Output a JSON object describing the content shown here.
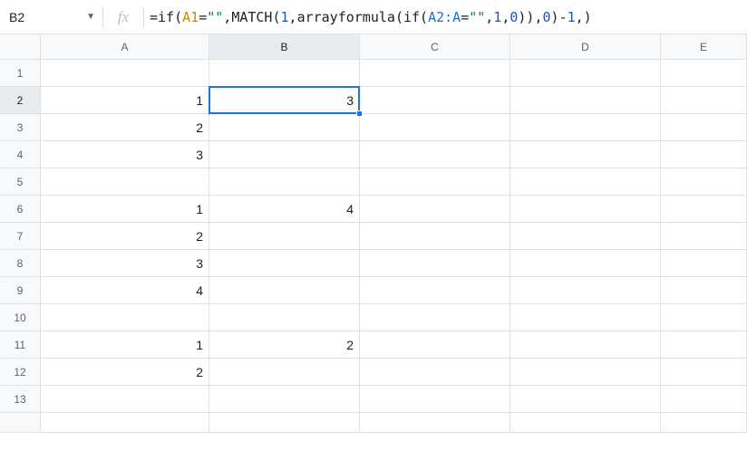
{
  "name_box": {
    "value": "B2"
  },
  "fx_label": "fx",
  "formula": {
    "raw": "=if(A1=\"\",MATCH(1,arrayformula(if(A2:A=\"\",1,0)),0)-1,)",
    "t0": "=",
    "t1": "if",
    "t2": "(",
    "t3": "A1",
    "t4": "=",
    "t5": "\"\"",
    "t6": ",",
    "t7": "MATCH",
    "t8": "(",
    "t9": "1",
    "t10": ",",
    "t11": "arrayformula",
    "t12": "(",
    "t13": "if",
    "t14": "(",
    "t15": "A2:A",
    "t16": "=",
    "t17": "\"\"",
    "t18": ",",
    "t19": "1",
    "t20": ",",
    "t21": "0",
    "t22": "))",
    "t23": ",",
    "t24": "0",
    "t25": ")",
    "t26": "-",
    "t27": "1",
    "t28": ",)"
  },
  "columns": {
    "c1": "A",
    "c2": "B",
    "c3": "C",
    "c4": "D",
    "c5": "E"
  },
  "rows": {
    "r1": "1",
    "r2": "2",
    "r3": "3",
    "r4": "4",
    "r5": "5",
    "r6": "6",
    "r7": "7",
    "r8": "8",
    "r9": "9",
    "r10": "10",
    "r11": "11",
    "r12": "12",
    "r13": "13"
  },
  "cells": {
    "A2": "1",
    "A3": "2",
    "A4": "3",
    "A6": "1",
    "A7": "2",
    "A8": "3",
    "A9": "4",
    "A11": "1",
    "A12": "2",
    "B2": "3",
    "B6": "4",
    "B11": "2"
  },
  "selection": {
    "cell": "B2"
  },
  "chart_data": {
    "type": "table",
    "columns": [
      "A",
      "B",
      "C",
      "D",
      "E"
    ],
    "rows": [
      {
        "row": 1,
        "A": "",
        "B": "",
        "C": "",
        "D": "",
        "E": ""
      },
      {
        "row": 2,
        "A": 1,
        "B": 3,
        "C": "",
        "D": "",
        "E": ""
      },
      {
        "row": 3,
        "A": 2,
        "B": "",
        "C": "",
        "D": "",
        "E": ""
      },
      {
        "row": 4,
        "A": 3,
        "B": "",
        "C": "",
        "D": "",
        "E": ""
      },
      {
        "row": 5,
        "A": "",
        "B": "",
        "C": "",
        "D": "",
        "E": ""
      },
      {
        "row": 6,
        "A": 1,
        "B": 4,
        "C": "",
        "D": "",
        "E": ""
      },
      {
        "row": 7,
        "A": 2,
        "B": "",
        "C": "",
        "D": "",
        "E": ""
      },
      {
        "row": 8,
        "A": 3,
        "B": "",
        "C": "",
        "D": "",
        "E": ""
      },
      {
        "row": 9,
        "A": 4,
        "B": "",
        "C": "",
        "D": "",
        "E": ""
      },
      {
        "row": 10,
        "A": "",
        "B": "",
        "C": "",
        "D": "",
        "E": ""
      },
      {
        "row": 11,
        "A": 1,
        "B": 2,
        "C": "",
        "D": "",
        "E": ""
      },
      {
        "row": 12,
        "A": 2,
        "B": "",
        "C": "",
        "D": "",
        "E": ""
      },
      {
        "row": 13,
        "A": "",
        "B": "",
        "C": "",
        "D": "",
        "E": ""
      }
    ]
  }
}
